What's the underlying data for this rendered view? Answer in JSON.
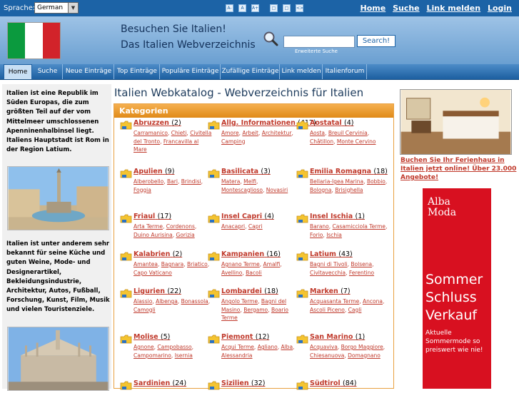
{
  "topbar": {
    "language_label": "Sprache:",
    "language_value": "German",
    "tools": [
      "A-",
      "A",
      "A+",
      "□",
      "□",
      "<>"
    ],
    "links": [
      "Home",
      "Suche",
      "Link melden",
      "Login"
    ]
  },
  "header": {
    "title_line1": "Besuchen Sie Italien!",
    "title_line2": "Das Italien Webverzeichnis",
    "search_button": "Search!",
    "advanced_search": "Erweiterte Suche"
  },
  "nav": [
    {
      "label": "Home",
      "active": true
    },
    {
      "label": "Suche"
    },
    {
      "label": "Neue Einträge"
    },
    {
      "label": "Top Einträge"
    },
    {
      "label": "Populäre Einträge"
    },
    {
      "label": "Zufällige Einträge"
    },
    {
      "label": "Link melden"
    },
    {
      "label": "Italienforum"
    }
  ],
  "left": {
    "intro": "Italien ist eine Republik im Süden Europas, die zum größten Teil auf der vom Mittelmeer umschlossenen Apenninenhalbinsel liegt. Italiens Hauptstadt ist Rom in der Region Latium.",
    "second": "Italien ist unter anderem sehr bekannt für seine Küche und guten Weine, Mode- und Designerartikel, Bekleidungsindustrie, Architektur, Autos, Fußball, Forschung, Kunst, Film, Musik und vielen Touristenziele."
  },
  "main": {
    "page_title": "Italien Webkatalog - Webverzeichnis für Italien",
    "categories_header": "Kategorien",
    "categories": [
      {
        "name": "Abruzzen",
        "count": "(2)",
        "subs": [
          "Carramanico",
          "Chieti",
          "Civitella del Tronto",
          "Francavilla al Mare"
        ]
      },
      {
        "name": "Allg. Informationen",
        "count": "(417)",
        "subs": [
          "Amore",
          "Arbeit",
          "Architektur",
          "Camping"
        ]
      },
      {
        "name": "Aostatal",
        "count": "(4)",
        "subs": [
          "Aosta",
          "Breuil Cervinia",
          "Châtillon",
          "Monte Cervino"
        ]
      },
      {
        "name": "Apulien",
        "count": "(9)",
        "subs": [
          "Alberobello",
          "Bari",
          "Brindisi",
          "Foggia"
        ]
      },
      {
        "name": "Basilicata",
        "count": "(3)",
        "subs": [
          "Matera",
          "Melfi",
          "Montescaglioso",
          "Novasiri"
        ]
      },
      {
        "name": "Emilia Romagna",
        "count": "(18)",
        "subs": [
          "Bellaria-Igea Marina",
          "Bobbio",
          "Bologna",
          "Brisighella"
        ]
      },
      {
        "name": "Friaul",
        "count": "(17)",
        "subs": [
          "Arta Terme",
          "Cordenons",
          "Duino Aurisina",
          "Gorizia"
        ]
      },
      {
        "name": "Insel Capri",
        "count": "(4)",
        "subs": [
          "Anacapri",
          "Capri"
        ]
      },
      {
        "name": "Insel Ischia",
        "count": "(1)",
        "subs": [
          "Barano",
          "Casamicciola Terme",
          "Forio",
          "Ischia"
        ]
      },
      {
        "name": "Kalabrien",
        "count": "(2)",
        "subs": [
          "Amantea",
          "Bagnara",
          "Briatico",
          "Capo Vaticano"
        ]
      },
      {
        "name": "Kampanien",
        "count": "(16)",
        "subs": [
          "Agnano Terme",
          "Amalfi",
          "Avellino",
          "Bacoli"
        ]
      },
      {
        "name": "Latium",
        "count": "(43)",
        "subs": [
          "Bagni di Tivoli",
          "Bolsena",
          "Civitavecchia",
          "Ferentino"
        ]
      },
      {
        "name": "Ligurien",
        "count": "(22)",
        "subs": [
          "Alassio",
          "Albenga",
          "Bonassola",
          "Camogli"
        ]
      },
      {
        "name": "Lombardei",
        "count": "(18)",
        "subs": [
          "Angolo Terme",
          "Bagni del Masino",
          "Bergamo",
          "Boario Terme"
        ]
      },
      {
        "name": "Marken",
        "count": "(7)",
        "subs": [
          "Acquasanta Terme",
          "Ancona",
          "Ascoli Piceno",
          "Cagli"
        ]
      },
      {
        "name": "Molise",
        "count": "(5)",
        "subs": [
          "Agnone",
          "Campobasso",
          "Campomarino",
          "Isernia"
        ]
      },
      {
        "name": "Piemont",
        "count": "(12)",
        "subs": [
          "Acqui Terme",
          "Agliano",
          "Alba",
          "Alessandria"
        ]
      },
      {
        "name": "San Marino",
        "count": "(1)",
        "subs": [
          "Acquaviva",
          "Borgo Maggiore",
          "Chiesanuova",
          "Domagnano"
        ]
      },
      {
        "name": "Sardinien",
        "count": "(24)",
        "subs": []
      },
      {
        "name": "Sizilien",
        "count": "(32)",
        "subs": []
      },
      {
        "name": "Südtirol",
        "count": "(84)",
        "subs": []
      }
    ]
  },
  "right": {
    "ad_text": "Buchen Sie Ihr Ferienhaus in Italien jetzt online! Über 23.000 Angebote!",
    "banner_logo": "Alba Moda",
    "banner_big": [
      "Sommer",
      "Schluss",
      "Verkauf"
    ],
    "banner_small": "Aktuelle Sommermode so preiswert wie nie!"
  },
  "colors": {
    "brand_blue": "#1c63a6",
    "accent_orange": "#e08a18",
    "link_red": "#c0392b",
    "flag": [
      "#0b9a3e",
      "#ffffff",
      "#d2232a"
    ]
  }
}
